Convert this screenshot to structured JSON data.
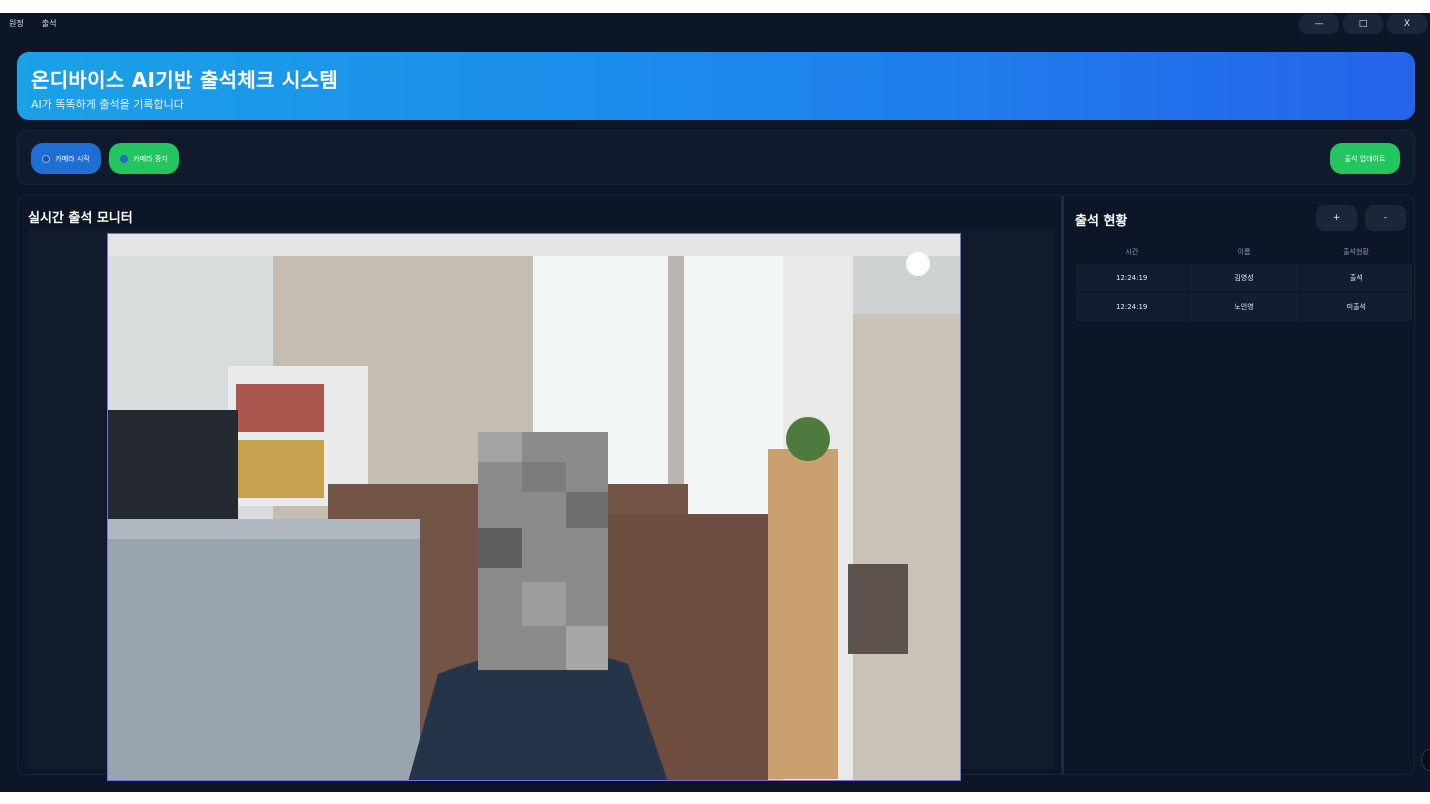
{
  "menu": {
    "items": [
      "원정",
      "출석"
    ]
  },
  "window": {
    "minimize": "—",
    "maximize": "□",
    "close": "X"
  },
  "header": {
    "title": "온디바이스 AI기반 출석체크 시스템",
    "subtitle": "AI가 똑똑하게 출석을 기록합니다"
  },
  "toolbar": {
    "camera_start": "카메라 시작",
    "camera_stop": "카메라 중지",
    "attendance_update": "출석 업데이트"
  },
  "monitor": {
    "title": "실시간 출석 모니터"
  },
  "attendance": {
    "title": "출석 현황",
    "add_label": "+",
    "remove_label": "-",
    "columns": [
      "시간",
      "이름",
      "출석현황"
    ],
    "rows": [
      [
        "12:24:19",
        "김영성",
        "출석"
      ],
      [
        "12:24:19",
        "노인영",
        "미출석"
      ]
    ]
  },
  "colors": {
    "background": "#0d1627",
    "header_gradient_start": "#1aa1e8",
    "header_gradient_end": "#2563eb",
    "start_button": "#1d6fd6",
    "green_button": "#22c55e",
    "camera_border": "#7c6fe0"
  }
}
